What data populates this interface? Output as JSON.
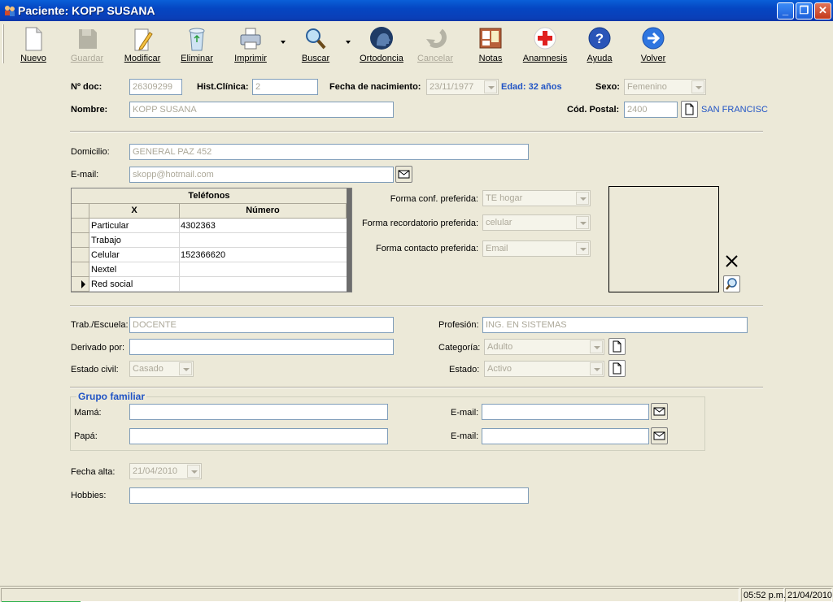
{
  "window": {
    "title": "Paciente: KOPP SUSANA"
  },
  "toolbar": {
    "buttons": [
      {
        "label": "Nuevo",
        "icon": "new-document-icon",
        "enabled": true
      },
      {
        "label": "Guardar",
        "icon": "save-disk-icon",
        "enabled": false
      },
      {
        "label": "Modificar",
        "icon": "edit-pencil-icon",
        "enabled": true
      },
      {
        "label": "Eliminar",
        "icon": "recycle-bin-icon",
        "enabled": true
      },
      {
        "label": "Imprimir",
        "icon": "printer-icon",
        "enabled": true
      },
      {
        "label": "Buscar",
        "icon": "magnifier-icon",
        "enabled": true
      },
      {
        "label": "Ortodoncia",
        "icon": "head-profile-icon",
        "enabled": true
      },
      {
        "label": "Cancelar",
        "icon": "undo-arrow-icon",
        "enabled": false
      },
      {
        "label": "Notas",
        "icon": "notes-board-icon",
        "enabled": true
      },
      {
        "label": "Anamnesis",
        "icon": "red-cross-icon",
        "enabled": true
      },
      {
        "label": "Ayuda",
        "icon": "help-icon",
        "enabled": true
      },
      {
        "label": "Volver",
        "icon": "back-arrow-icon",
        "enabled": true
      }
    ]
  },
  "header": {
    "doc_label": "Nº doc:",
    "doc_value": "26309299",
    "hist_label": "Hist.Clínica:",
    "hist_value": "2",
    "birth_label": "Fecha de nacimiento:",
    "birth_value": "23/11/1977",
    "age_text": "Edad: 32 años",
    "sex_label": "Sexo:",
    "sex_value": "Femenino",
    "name_label": "Nombre:",
    "name_value": "KOPP SUSANA",
    "postal_label": "Cód. Postal:",
    "postal_value": "2400",
    "city_text": "SAN FRANCISC"
  },
  "contact": {
    "address_label": "Domicilio:",
    "address_value": "GENERAL PAZ 452",
    "email_label": "E-mail:",
    "email_value": "skopp@hotmail.com"
  },
  "phones": {
    "title": "Teléfonos",
    "col_x": "X",
    "col_number": "Número",
    "rows": [
      {
        "type": "Particular",
        "number": "4302363"
      },
      {
        "type": "Trabajo",
        "number": ""
      },
      {
        "type": "Celular",
        "number": "152366620"
      },
      {
        "type": "Nextel",
        "number": ""
      },
      {
        "type": "Red social",
        "number": ""
      }
    ]
  },
  "preferences": {
    "conf_label": "Forma conf. preferida:",
    "conf_value": "TE hogar",
    "reminder_label": "Forma recordatorio preferida:",
    "reminder_value": "celular",
    "contact_label": "Forma contacto preferida:",
    "contact_value": "Email"
  },
  "work": {
    "school_label": "Trab./Escuela:",
    "school_value": "DOCENTE",
    "profession_label": "Profesión:",
    "profession_value": "ING. EN SISTEMAS",
    "referred_label": "Derivado por:",
    "referred_value": "",
    "category_label": "Categoría:",
    "category_value": "Adulto",
    "civil_label": "Estado civil:",
    "civil_value": "Casado",
    "status_label": "Estado:",
    "status_value": "Activo"
  },
  "family": {
    "title": "Grupo familiar",
    "mom_label": "Mamá:",
    "mom_value": "",
    "mom_email_label": "E-mail:",
    "mom_email_value": "",
    "dad_label": "Papá:",
    "dad_value": "",
    "dad_email_label": "E-mail:",
    "dad_email_value": ""
  },
  "extra": {
    "signup_label": "Fecha alta:",
    "signup_value": "21/04/2010",
    "hobbies_label": "Hobbies:",
    "hobbies_value": ""
  },
  "statusbar": {
    "time": "05:52 p.m.",
    "date": "21/04/2010"
  }
}
